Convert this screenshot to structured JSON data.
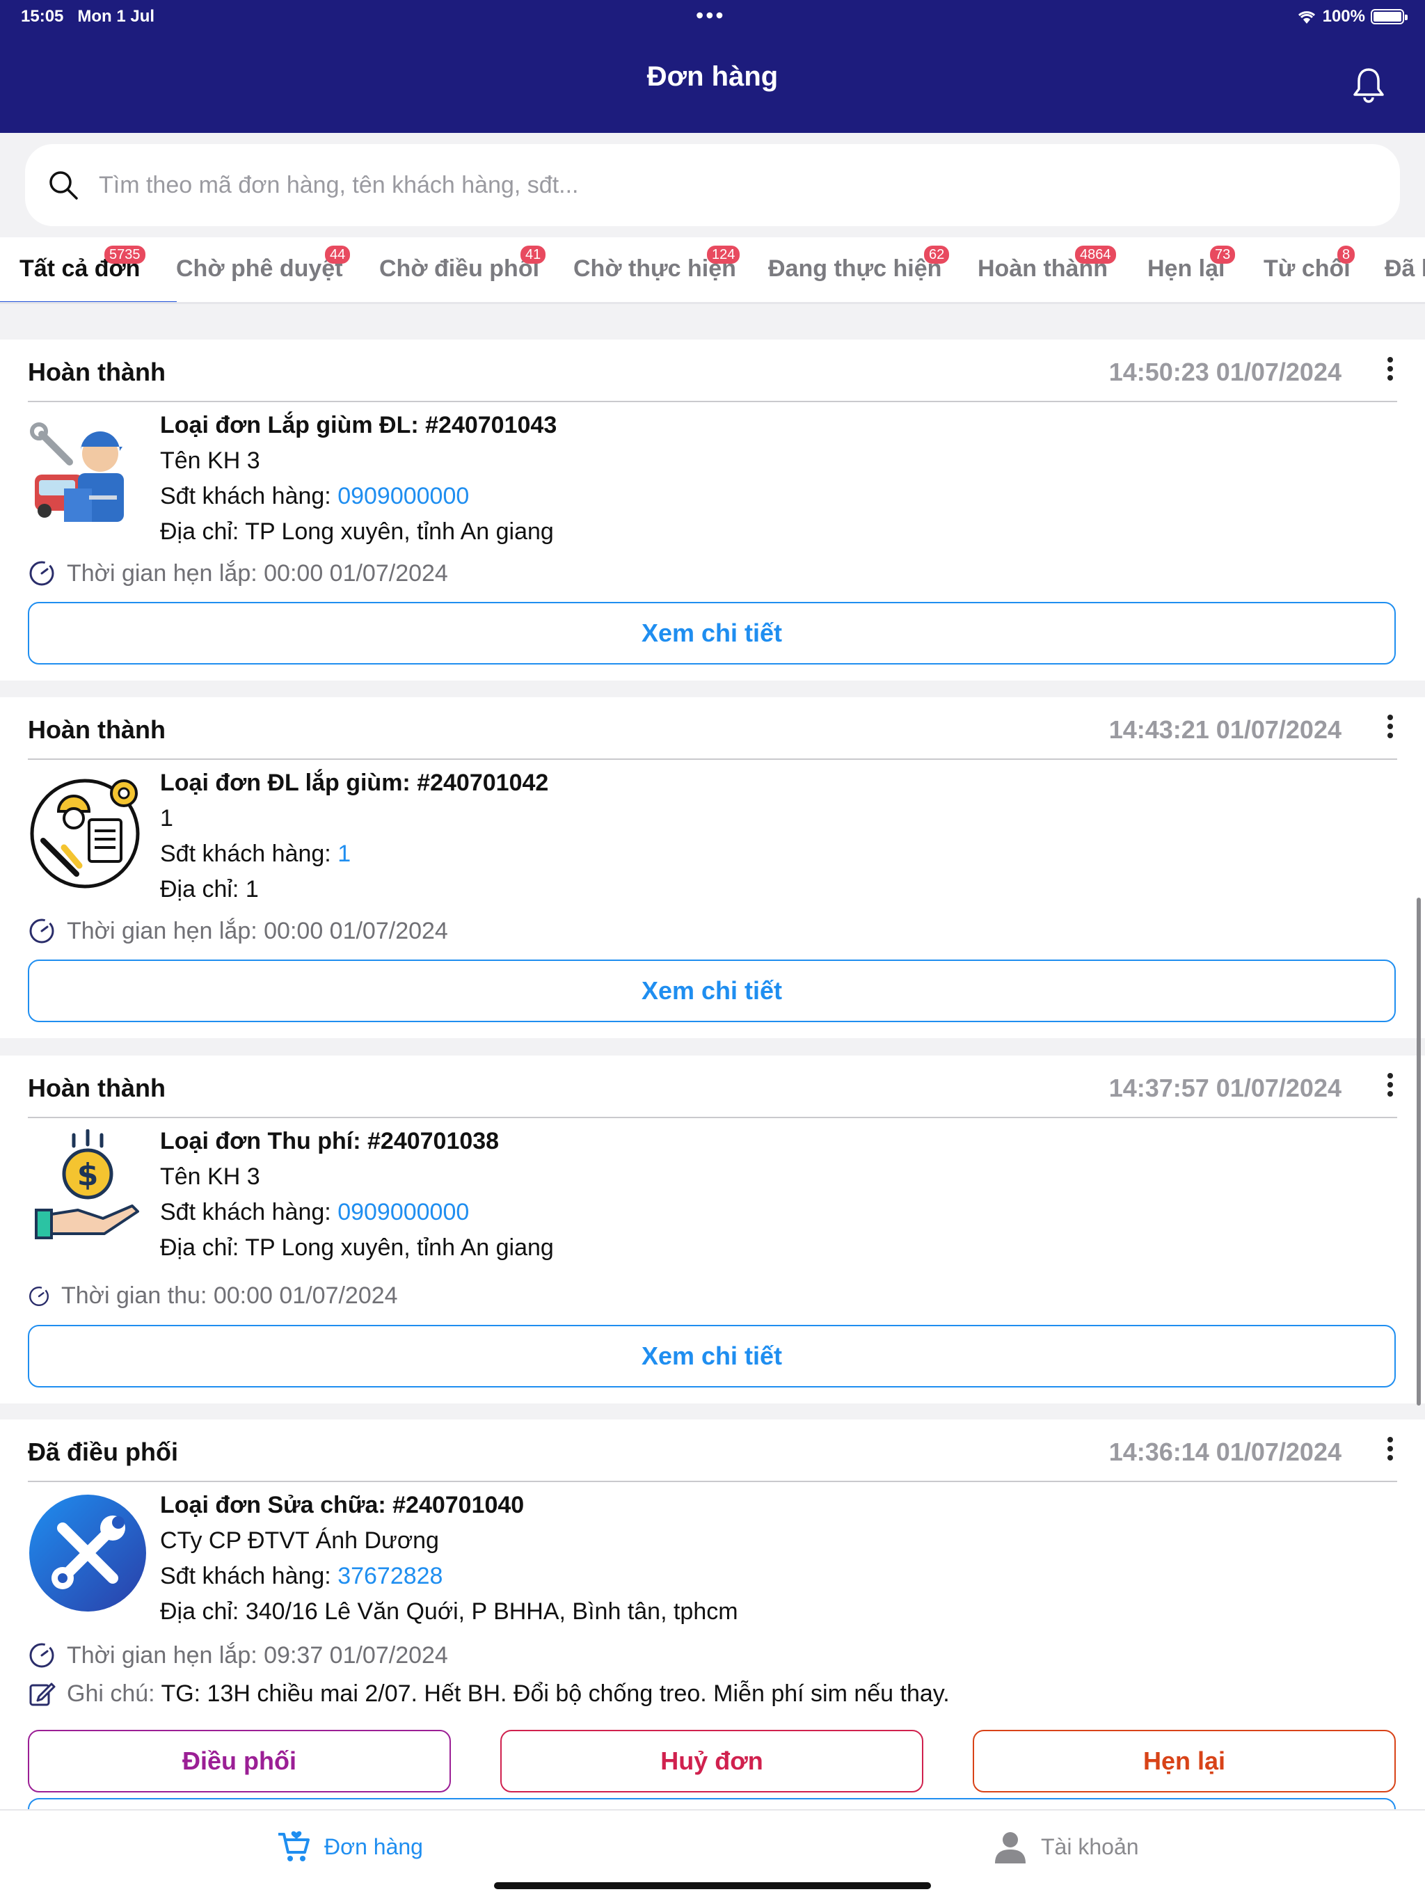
{
  "status_bar": {
    "time": "15:05",
    "date": "Mon 1 Jul",
    "dots": "•••",
    "battery_label": "100%",
    "battery_level": 1.0
  },
  "header": {
    "title": "Đơn hàng",
    "bell_icon": "bell-icon"
  },
  "search": {
    "placeholder": "Tìm theo mã đơn hàng, tên khách hàng, sđt...",
    "value": ""
  },
  "tabs": [
    {
      "label": "Tất cả đơn",
      "badge": "5735",
      "active": true
    },
    {
      "label": "Chờ phê duyệt",
      "badge": "44"
    },
    {
      "label": "Chờ điều phối",
      "badge": "41"
    },
    {
      "label": "Chờ thực hiện",
      "badge": "124"
    },
    {
      "label": "Đang thực hiện",
      "badge": "62"
    },
    {
      "label": "Hoàn thành",
      "badge": "4864"
    },
    {
      "label": "Hẹn lại",
      "badge": "73"
    },
    {
      "label": "Từ chối",
      "badge": "8"
    },
    {
      "label": "Đã h",
      "badge": ""
    }
  ],
  "orders": [
    {
      "status": "Hoàn thành",
      "time": "14:50:23 01/07/2024",
      "type_line": "Loại đơn Lắp giùm ĐL: #240701043",
      "customer": "Tên KH 3",
      "phone_label": "Sđt khách hàng: ",
      "phone": "0909000000",
      "address": "Địa chỉ: TP Long xuyên, tỉnh An giang",
      "schedule_label": "Thời gian hẹn lắp: ",
      "schedule_value": "00:00 01/07/2024",
      "detail_button": "Xem chi tiết",
      "image_icon": "mechanic-illustration"
    },
    {
      "status": "Hoàn thành",
      "time": "14:43:21 01/07/2024",
      "type_line": "Loại đơn ĐL lắp giùm: #240701042",
      "customer": "1",
      "phone_label": "Sđt khách hàng: ",
      "phone": "1",
      "address": "Địa chỉ: 1",
      "schedule_label": "Thời gian hẹn lắp: ",
      "schedule_value": "00:00 01/07/2024",
      "detail_button": "Xem chi tiết",
      "image_icon": "technician-clipboard-illustration"
    },
    {
      "status": "Hoàn thành",
      "time": "14:37:57 01/07/2024",
      "type_line": "Loại đơn Thu phí: #240701038",
      "customer": "Tên KH 3",
      "phone_label": "Sđt khách hàng: ",
      "phone": "0909000000",
      "address": "Địa chỉ: TP Long xuyên, tỉnh An giang",
      "schedule_label": "Thời gian thu: ",
      "schedule_value": "00:00 01/07/2024",
      "detail_button": "Xem chi tiết",
      "image_icon": "hand-coin-illustration"
    },
    {
      "status": "Đã điều phối",
      "time": "14:36:14 01/07/2024",
      "type_line": "Loại đơn Sửa chữa: #240701040",
      "customer": "CTy CP ĐTVT Ánh Dương",
      "phone_label": "Sđt khách hàng: ",
      "phone": "37672828",
      "address": "Địa chỉ: 340/16 Lê Văn Quới, P BHHA, Bình tân, tphcm",
      "schedule_label": "Thời gian hẹn lắp: ",
      "schedule_value": "09:37 01/07/2024",
      "note_label": "Ghi chú: ",
      "note_value": "TG: 13H chiều mai 2/07. Hết BH. Đổi bộ chống treo. Miễn phí sim nếu thay.",
      "actions": {
        "dispatch": "Điều phối",
        "cancel": "Huỷ đơn",
        "reschedule": "Hẹn lại"
      },
      "image_icon": "tools-circle-icon"
    }
  ],
  "bottom_nav": {
    "orders": "Đơn hàng",
    "account": "Tài khoản"
  },
  "colors": {
    "header": "#1d1c7d",
    "link": "#1f8ef0",
    "badge": "#e84a5f",
    "dispatch": "#9b1f95",
    "cancel": "#d0214e",
    "reschedule": "#d84318"
  }
}
